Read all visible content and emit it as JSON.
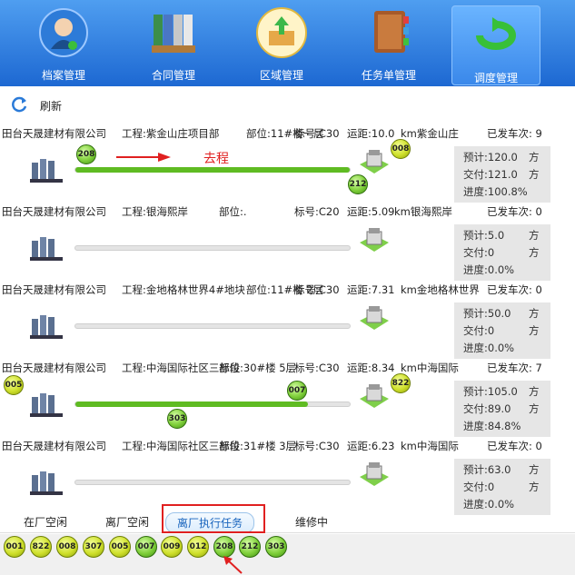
{
  "nav": {
    "items": [
      {
        "label": "档案管理",
        "icon": "user-profile-icon"
      },
      {
        "label": "合同管理",
        "icon": "binders-icon"
      },
      {
        "label": "区域管理",
        "icon": "upload-box-icon"
      },
      {
        "label": "任务单管理",
        "icon": "notebook-icon"
      },
      {
        "label": "调度管理",
        "icon": "cycle-arrow-icon"
      }
    ],
    "active_index": 4
  },
  "toolbar": {
    "refresh_label": "刷新"
  },
  "direction_label": "去程",
  "tasks": [
    {
      "company": "田台天晟建材有限公司",
      "project": "工程:紫金山庄项目部",
      "part": "部位:11#楼一层",
      "grade": "标号:C30",
      "distance": "运距:10.0",
      "km_site": "km紫金山庄",
      "sent": "已发车次: 9",
      "planned": "预计:120.0",
      "delivered": "交付:121.0",
      "progress": "进度:100.8%",
      "unit1": "方",
      "unit2": "方",
      "progress_value": 1.0,
      "vehicles": [
        {
          "id": "208",
          "style": "green"
        },
        {
          "id": "212",
          "style": "green"
        },
        {
          "id": "008",
          "style": "yellow"
        }
      ]
    },
    {
      "company": "田台天晟建材有限公司",
      "project": "工程:银海熙岸",
      "part": "部位:.",
      "grade": "标号:C20",
      "distance": "运距:5.09",
      "km_site": "km银海熙岸",
      "sent": "已发车次: 0",
      "planned": "预计:5.0",
      "delivered": "交付:0",
      "progress": "进度:0.0%",
      "unit1": "方",
      "unit2": "方",
      "progress_value": 0.0,
      "vehicles": []
    },
    {
      "company": "田台天晟建材有限公司",
      "project": "工程:金地格林世界4#地块",
      "part": "部位:11#楼 2层",
      "grade": "标号:C30",
      "distance": "运距:7.31",
      "km_site": "km金地格林世界",
      "sent": "已发车次: 0",
      "planned": "预计:50.0",
      "delivered": "交付:0",
      "progress": "进度:0.0%",
      "unit1": "方",
      "unit2": "方",
      "progress_value": 0.0,
      "vehicles": []
    },
    {
      "company": "田台天晟建材有限公司",
      "project": "工程:中海国际社区三标段",
      "part": "部位:30#楼 5层",
      "grade": "标号:C30",
      "distance": "运距:8.34",
      "km_site": "km中海国际",
      "sent": "已发车次: 7",
      "planned": "预计:105.0",
      "delivered": "交付:89.0",
      "progress": "进度:84.8%",
      "unit1": "方",
      "unit2": "方",
      "progress_value": 0.848,
      "vehicles": [
        {
          "id": "005",
          "style": "yellow"
        },
        {
          "id": "007",
          "style": "green"
        },
        {
          "id": "303",
          "style": "green"
        },
        {
          "id": "822",
          "style": "yellow"
        }
      ]
    },
    {
      "company": "田台天晟建材有限公司",
      "project": "工程:中海国际社区三标段",
      "part": "部位:31#楼 3层",
      "grade": "标号:C30",
      "distance": "运距:6.23",
      "km_site": "km中海国际",
      "sent": "已发车次: 0",
      "planned": "预计:63.0",
      "delivered": "交付:0",
      "progress": "进度:0.0%",
      "unit1": "方",
      "unit2": "方",
      "progress_value": 0.0,
      "vehicles": []
    }
  ],
  "tabs": [
    {
      "label": "在厂空闲"
    },
    {
      "label": "离厂空闲"
    },
    {
      "label": "离厂执行任务"
    },
    {
      "label": "维修中"
    }
  ],
  "active_tab": 2,
  "vehicle_strip": [
    {
      "id": "001",
      "style": "yellow"
    },
    {
      "id": "822",
      "style": "yellow"
    },
    {
      "id": "008",
      "style": "yellow"
    },
    {
      "id": "307",
      "style": "yellow"
    },
    {
      "id": "005",
      "style": "yellow"
    },
    {
      "id": "007",
      "style": "green"
    },
    {
      "id": "009",
      "style": "yellow"
    },
    {
      "id": "012",
      "style": "yellow"
    },
    {
      "id": "208",
      "style": "green"
    },
    {
      "id": "212",
      "style": "green"
    },
    {
      "id": "303",
      "style": "green"
    }
  ],
  "colors": {
    "nav_top": "#4f9ef0",
    "nav_bottom": "#1d68d2",
    "progress_fill": "#5fbb22",
    "annotation_red": "#e02020"
  }
}
